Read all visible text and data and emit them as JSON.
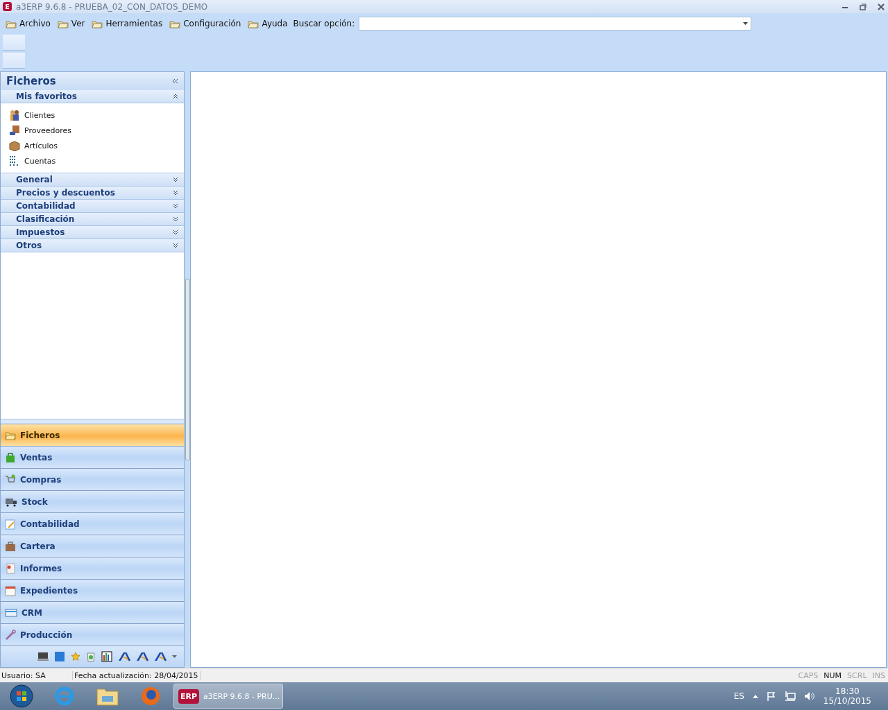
{
  "window": {
    "app_icon_letter": "E",
    "title": "a3ERP 9.6.8 - PRUEBA_02_CON_DATOS_DEMO"
  },
  "menu": {
    "items": [
      "Archivo",
      "Ver",
      "Herramientas",
      "Configuración",
      "Ayuda"
    ],
    "search": {
      "label": "Buscar opción:"
    }
  },
  "sidebar": {
    "title": "Ficheros",
    "groups": [
      {
        "label": "Mis favoritos",
        "expanded": true,
        "items": [
          {
            "label": "Clientes",
            "kind": "people"
          },
          {
            "label": "Proveedores",
            "kind": "supplier"
          },
          {
            "label": "Artículos",
            "kind": "box"
          },
          {
            "label": "Cuentas",
            "kind": "accounts"
          }
        ]
      },
      {
        "label": "General",
        "expanded": false
      },
      {
        "label": "Precios y descuentos",
        "expanded": false
      },
      {
        "label": "Contabilidad",
        "expanded": false
      },
      {
        "label": "Clasificación",
        "expanded": false
      },
      {
        "label": "Impuestos",
        "expanded": false
      },
      {
        "label": "Otros",
        "expanded": false
      }
    ],
    "modules": [
      {
        "label": "Ficheros",
        "kind": "folder",
        "selected": true
      },
      {
        "label": "Ventas",
        "kind": "bag",
        "selected": false
      },
      {
        "label": "Compras",
        "kind": "cart",
        "selected": false
      },
      {
        "label": "Stock",
        "kind": "truck",
        "selected": false
      },
      {
        "label": "Contabilidad",
        "kind": "notepad",
        "selected": false
      },
      {
        "label": "Cartera",
        "kind": "briefcase",
        "selected": false
      },
      {
        "label": "Informes",
        "kind": "report",
        "selected": false
      },
      {
        "label": "Expedientes",
        "kind": "calendar",
        "selected": false
      },
      {
        "label": "CRM",
        "kind": "card",
        "selected": false
      },
      {
        "label": "Producción",
        "kind": "wrench",
        "selected": false
      }
    ]
  },
  "status_bar": {
    "user": "Usuario: SA",
    "updated": "Fecha actualización: 28/04/2015",
    "indicators": [
      {
        "label": "CAPS",
        "on": false
      },
      {
        "label": "NUM",
        "on": true
      },
      {
        "label": "SCRL",
        "on": false
      },
      {
        "label": "INS",
        "on": false
      }
    ]
  },
  "taskbar": {
    "task": {
      "logo": "ERP",
      "label": "a3ERP 9.6.8 - PRU..."
    },
    "language": "ES",
    "time": "18:30",
    "date": "15/10/2015"
  }
}
